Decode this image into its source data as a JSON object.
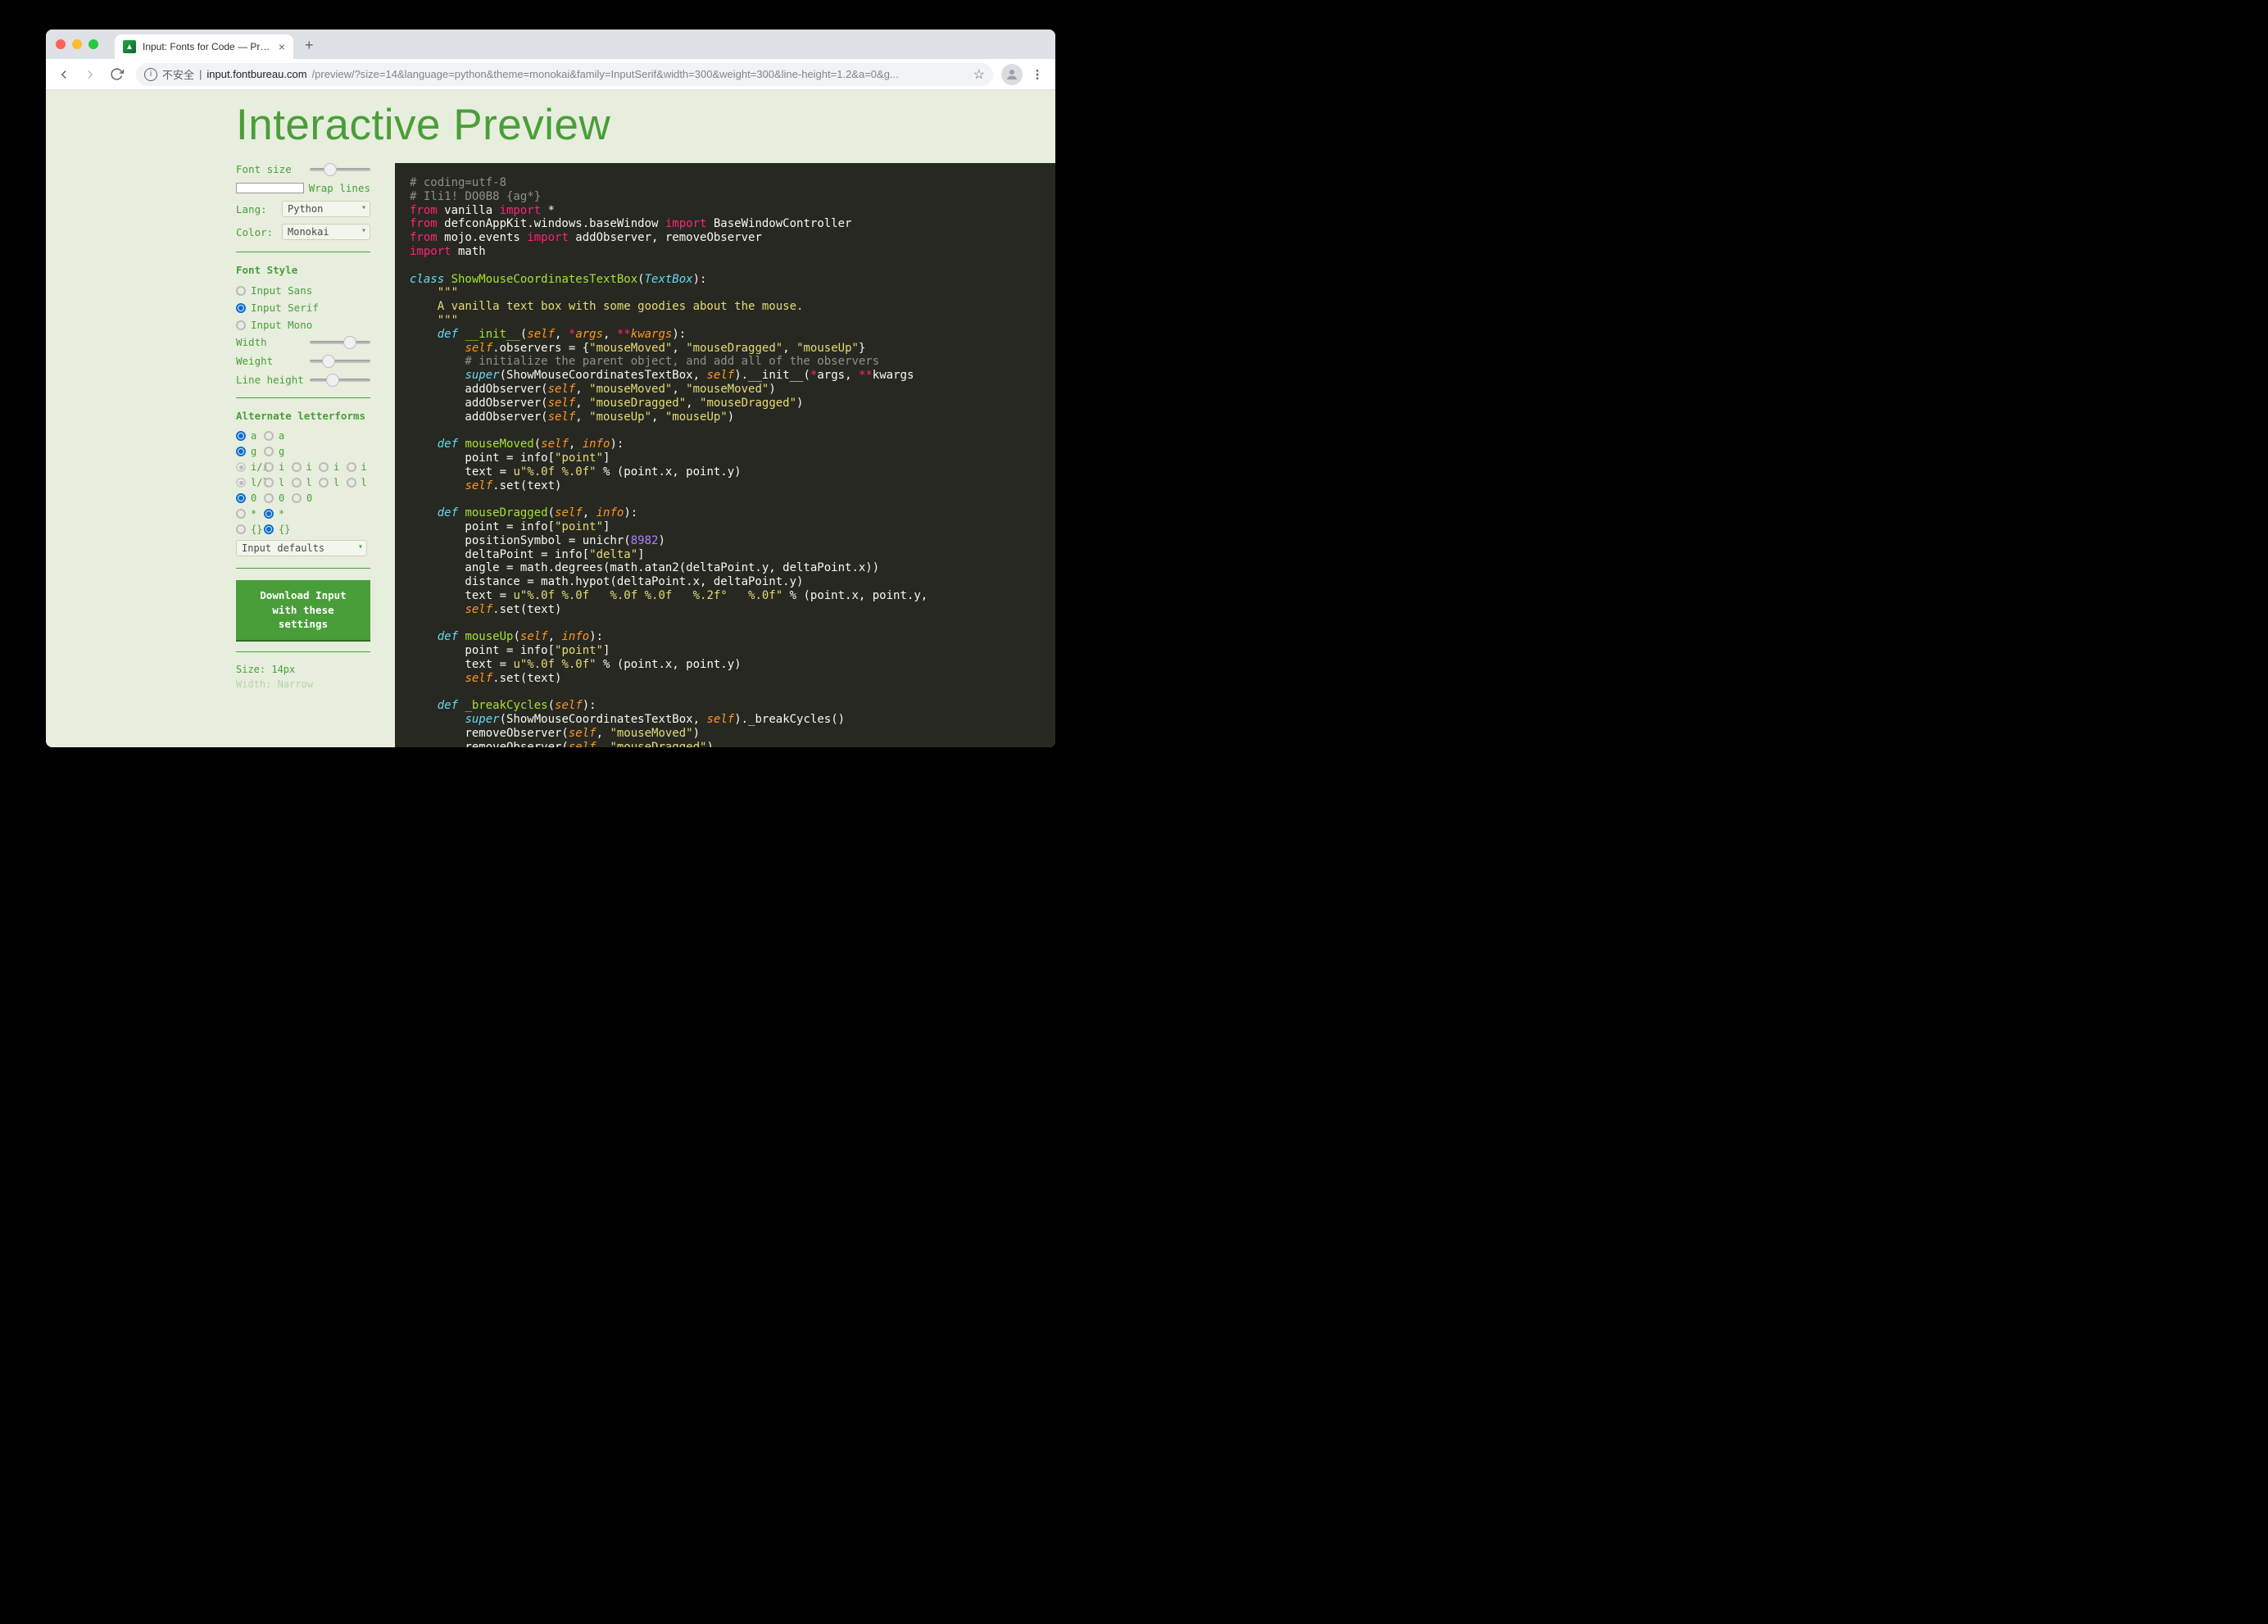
{
  "browser": {
    "tab_title": "Input: Fonts for Code — Previe",
    "insecure_label": "不安全",
    "url_host": "input.fontbureau.com",
    "url_path": "/preview/?size=14&language=python&theme=monokai&family=InputSerif&width=300&weight=300&line-height=1.2&a=0&g..."
  },
  "page": {
    "title": "Interactive Preview"
  },
  "sidebar": {
    "font_size_label": "Font size",
    "wrap_lines_label": "Wrap lines",
    "lang_label": "Lang:",
    "lang_value": "Python",
    "color_label": "Color:",
    "color_value": "Monokai",
    "font_style_heading": "Font Style",
    "font_styles": [
      {
        "label": "Input Sans",
        "selected": false
      },
      {
        "label": "Input Serif",
        "selected": true
      },
      {
        "label": "Input Mono",
        "selected": false
      }
    ],
    "width_label": "Width",
    "weight_label": "Weight",
    "lineheight_label": "Line height",
    "alt_heading": "Alternate letterforms",
    "alt_rows": [
      {
        "opts": [
          "a",
          "a"
        ],
        "sel": 0,
        "dimFirst": false
      },
      {
        "opts": [
          "g",
          "g"
        ],
        "sel": 0,
        "dimFirst": false
      },
      {
        "opts": [
          "i/i",
          "i",
          "i",
          "i",
          "i"
        ],
        "sel": -1,
        "dimFirst": true
      },
      {
        "opts": [
          "l/l",
          "l",
          "l",
          "l",
          "l"
        ],
        "sel": -1,
        "dimFirst": true
      },
      {
        "opts": [
          "0",
          "0",
          "0"
        ],
        "sel": 0,
        "dimFirst": false
      },
      {
        "opts": [
          "*",
          "*"
        ],
        "sel": 1,
        "dimFirst": false
      },
      {
        "opts": [
          "{}",
          "{}"
        ],
        "sel": 1,
        "dimFirst": false
      }
    ],
    "defaults_select": "Input defaults",
    "download_line1": "Download Input",
    "download_line2": "with these settings",
    "summary_size": "Size: 14px",
    "summary_width": "Width: Narrow"
  },
  "code": {
    "l1": "# coding=utf-8",
    "l2": "# Ili1! DO0B8 {ag*}",
    "l3a": "from",
    "l3b": " vanilla ",
    "l3c": "import",
    "l3d": " *",
    "l4a": "from",
    "l4b": " defconAppKit.windows.baseWindow ",
    "l4c": "import",
    "l4d": " BaseWindowController",
    "l5a": "from",
    "l5b": " mojo.events ",
    "l5c": "import",
    "l5d": " addObserver, removeObserver",
    "l6a": "import",
    "l6b": " math",
    "l8a": "class ",
    "l8b": "ShowMouseCoordinatesTextBox",
    "l8c": "(",
    "l8d": "TextBox",
    "l8e": "):",
    "l9": "    \"\"\"",
    "l10": "    A vanilla text box with some goodies about the mouse.",
    "l11": "    \"\"\"",
    "l12a": "    ",
    "l12b": "def ",
    "l12c": "__init__",
    "l12d": "(",
    "l12e": "self",
    "l12f": ", ",
    "l12g": "*",
    "l12h": "args",
    "l12i": ", ",
    "l12j": "**",
    "l12k": "kwargs",
    "l12l": "):",
    "l13a": "        ",
    "l13b": "self",
    "l13c": ".observers = {",
    "l13d": "\"mouseMoved\"",
    "l13e": ", ",
    "l13f": "\"mouseDragged\"",
    "l13g": ", ",
    "l13h": "\"mouseUp\"",
    "l13i": "}",
    "l14": "        # initialize the parent object, and add all of the observers",
    "l15a": "        ",
    "l15b": "super",
    "l15c": "(ShowMouseCoordinatesTextBox, ",
    "l15d": "self",
    "l15e": ").",
    "l15f": "__init__",
    "l15g": "(",
    "l15h": "*",
    "l15i": "args, ",
    "l15j": "**",
    "l15k": "kwargs",
    "l16a": "        addObserver(",
    "l16b": "self",
    "l16c": ", ",
    "l16d": "\"mouseMoved\"",
    "l16e": ", ",
    "l16f": "\"mouseMoved\"",
    "l16g": ")",
    "l17a": "        addObserver(",
    "l17b": "self",
    "l17c": ", ",
    "l17d": "\"mouseDragged\"",
    "l17e": ", ",
    "l17f": "\"mouseDragged\"",
    "l17g": ")",
    "l18a": "        addObserver(",
    "l18b": "self",
    "l18c": ", ",
    "l18d": "\"mouseUp\"",
    "l18e": ", ",
    "l18f": "\"mouseUp\"",
    "l18g": ")",
    "l20a": "    ",
    "l20b": "def ",
    "l20c": "mouseMoved",
    "l20d": "(",
    "l20e": "self",
    "l20f": ", ",
    "l20g": "info",
    "l20h": "):",
    "l21a": "        point = info[",
    "l21b": "\"point\"",
    "l21c": "]",
    "l22a": "        text = ",
    "l22b": "u\"%.0f %.0f\"",
    "l22c": " % (point.x, point.y)",
    "l23a": "        ",
    "l23b": "self",
    "l23c": ".set(text)",
    "l25a": "    ",
    "l25b": "def ",
    "l25c": "mouseDragged",
    "l25d": "(",
    "l25e": "self",
    "l25f": ", ",
    "l25g": "info",
    "l25h": "):",
    "l26a": "        point = info[",
    "l26b": "\"point\"",
    "l26c": "]",
    "l27a": "        positionSymbol = unichr(",
    "l27b": "8982",
    "l27c": ")",
    "l28a": "        deltaPoint = info[",
    "l28b": "\"delta\"",
    "l28c": "]",
    "l29": "        angle = math.degrees(math.atan2(deltaPoint.y, deltaPoint.x))",
    "l30": "        distance = math.hypot(deltaPoint.x, deltaPoint.y)",
    "l31a": "        text = ",
    "l31b": "u\"%.0f %.0f   %.0f %.0f   %.2f°   %.0f\"",
    "l31c": " % (point.x, point.y,",
    "l32a": "        ",
    "l32b": "self",
    "l32c": ".set(text)",
    "l34a": "    ",
    "l34b": "def ",
    "l34c": "mouseUp",
    "l34d": "(",
    "l34e": "self",
    "l34f": ", ",
    "l34g": "info",
    "l34h": "):",
    "l35a": "        point = info[",
    "l35b": "\"point\"",
    "l35c": "]",
    "l36a": "        text = ",
    "l36b": "u\"%.0f %.0f\"",
    "l36c": " % (point.x, point.y)",
    "l37a": "        ",
    "l37b": "self",
    "l37c": ".set(text)",
    "l39a": "    ",
    "l39b": "def ",
    "l39c": "_breakCycles",
    "l39d": "(",
    "l39e": "self",
    "l39f": "):",
    "l40a": "        ",
    "l40b": "super",
    "l40c": "(ShowMouseCoordinatesTextBox, ",
    "l40d": "self",
    "l40e": ")._breakCycles()",
    "l41a": "        removeObserver(",
    "l41b": "self",
    "l41c": ", ",
    "l41d": "\"mouseMoved\"",
    "l41e": ")",
    "l42a": "        removeObserver(",
    "l42b": "self",
    "l42c": ", ",
    "l42d": "\"mouseDragged\"",
    "l42e": ")"
  }
}
